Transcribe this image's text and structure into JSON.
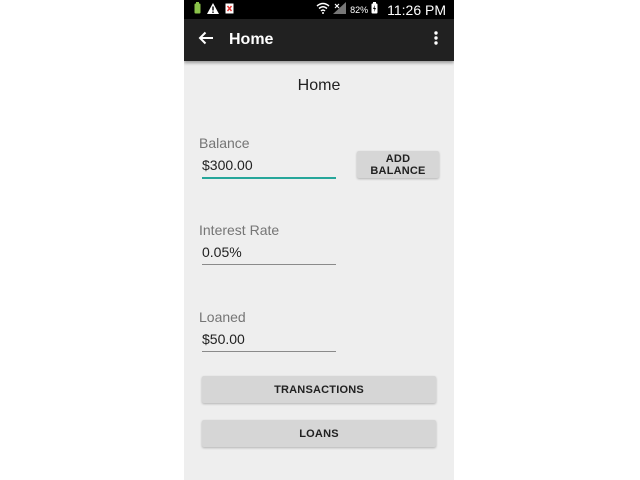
{
  "status_bar": {
    "battery_percent": "82%",
    "time": "11:26 PM"
  },
  "app_bar": {
    "title": "Home"
  },
  "page": {
    "title": "Home"
  },
  "fields": {
    "balance": {
      "label": "Balance",
      "value": "$300.00"
    },
    "interest_rate": {
      "label": "Interest Rate",
      "value": "0.05%"
    },
    "loaned": {
      "label": "Loaned",
      "value": "$50.00"
    }
  },
  "buttons": {
    "add_balance": "ADD BALANCE",
    "transactions": "TRANSACTIONS",
    "loans": "LOANS"
  },
  "colors": {
    "accent": "#26a69a",
    "app_bar": "#212121",
    "background": "#eeeeee",
    "button": "#d6d6d6"
  },
  "icons": [
    "battery-icon",
    "warning-icon",
    "notification-icon",
    "wifi-icon",
    "signal-icon",
    "battery-charging-icon",
    "back-arrow-icon",
    "overflow-menu-icon"
  ]
}
